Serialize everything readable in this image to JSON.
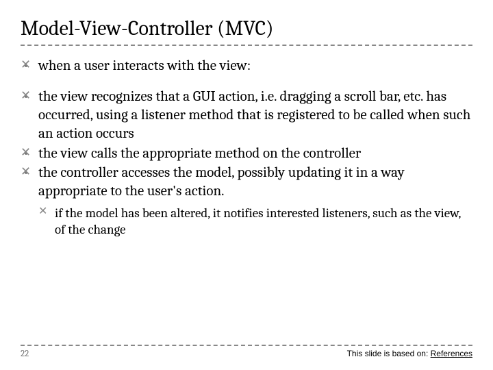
{
  "title": "Model-View-Controller (MVC)",
  "bullets": {
    "b1": "when a user interacts with the view:",
    "b2": "the view recognizes that a GUI action, i.e. dragging a scroll bar, etc. has occurred, using a listener method that is registered to be called when such an action occurs",
    "b3": "the view calls the appropriate method on the controller",
    "b4": "the controller accesses the model, possibly updating it in a way appropriate to the user's action.",
    "b4a": "if the model has been altered, it notifies interested listeners, such as the view, of the change"
  },
  "footer": {
    "page": "22",
    "ref_prefix": "This slide is based on: ",
    "ref_link": "References"
  }
}
